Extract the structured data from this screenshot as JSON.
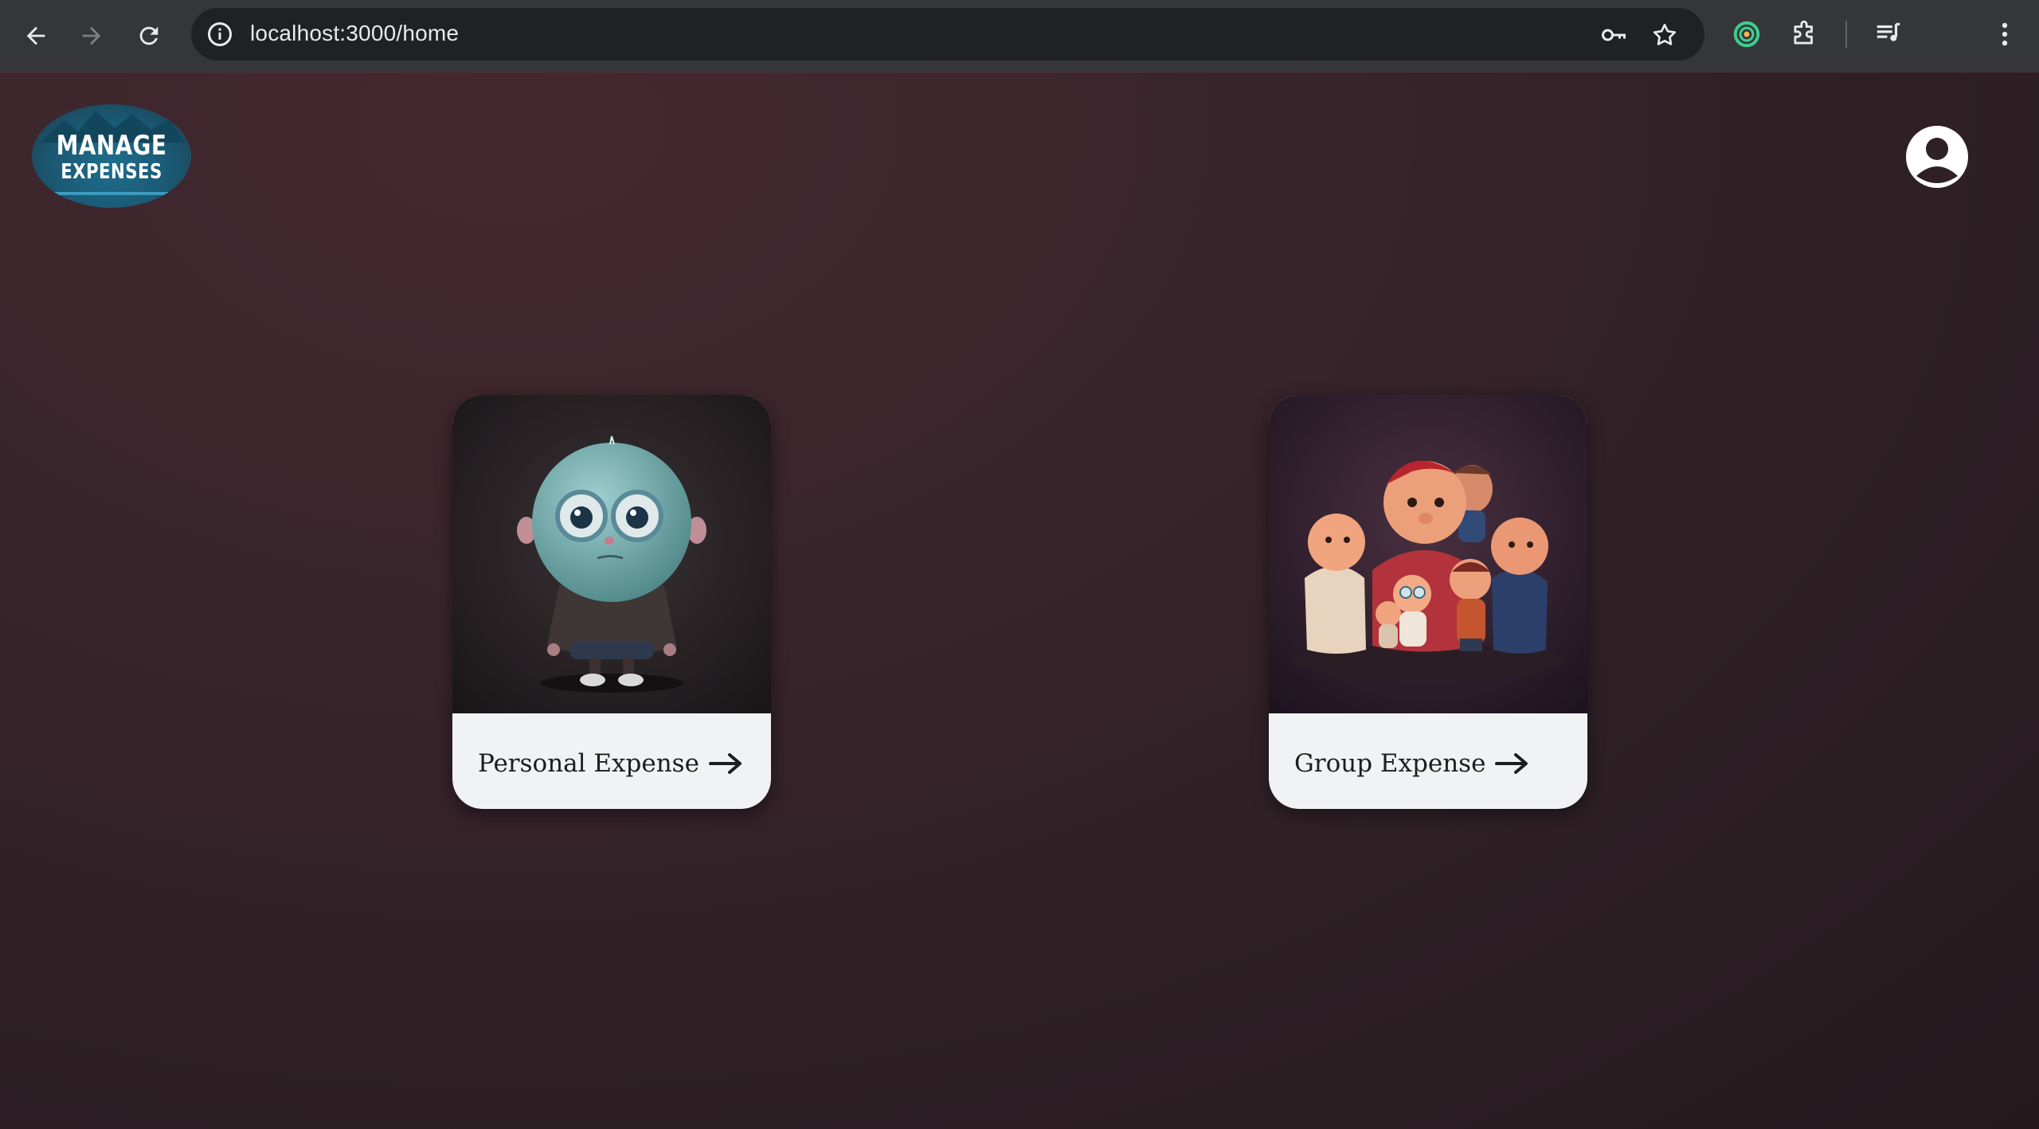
{
  "browser": {
    "url": "localhost:3000/home",
    "icons": [
      "back-arrow-icon",
      "forward-arrow-icon",
      "reload-icon",
      "site-info-icon",
      "password-key-icon",
      "bookmark-star-icon",
      "extension-circle-icon",
      "puzzle-piece-icon",
      "media-queue-icon",
      "kebab-menu-icon"
    ]
  },
  "header": {
    "logo_line1": "MANAGE",
    "logo_line2": "EXPENSES",
    "avatar_icon": "user-avatar-icon"
  },
  "cards": [
    {
      "label": "Personal Expense",
      "image": "single-cartoon-character"
    },
    {
      "label": "Group Expense",
      "image": "group-of-cartoon-characters"
    }
  ],
  "colors": {
    "page_bg": "#2e2025",
    "card_caption_bg": "#f1f2f4",
    "logo_bg": "#1a5872"
  }
}
